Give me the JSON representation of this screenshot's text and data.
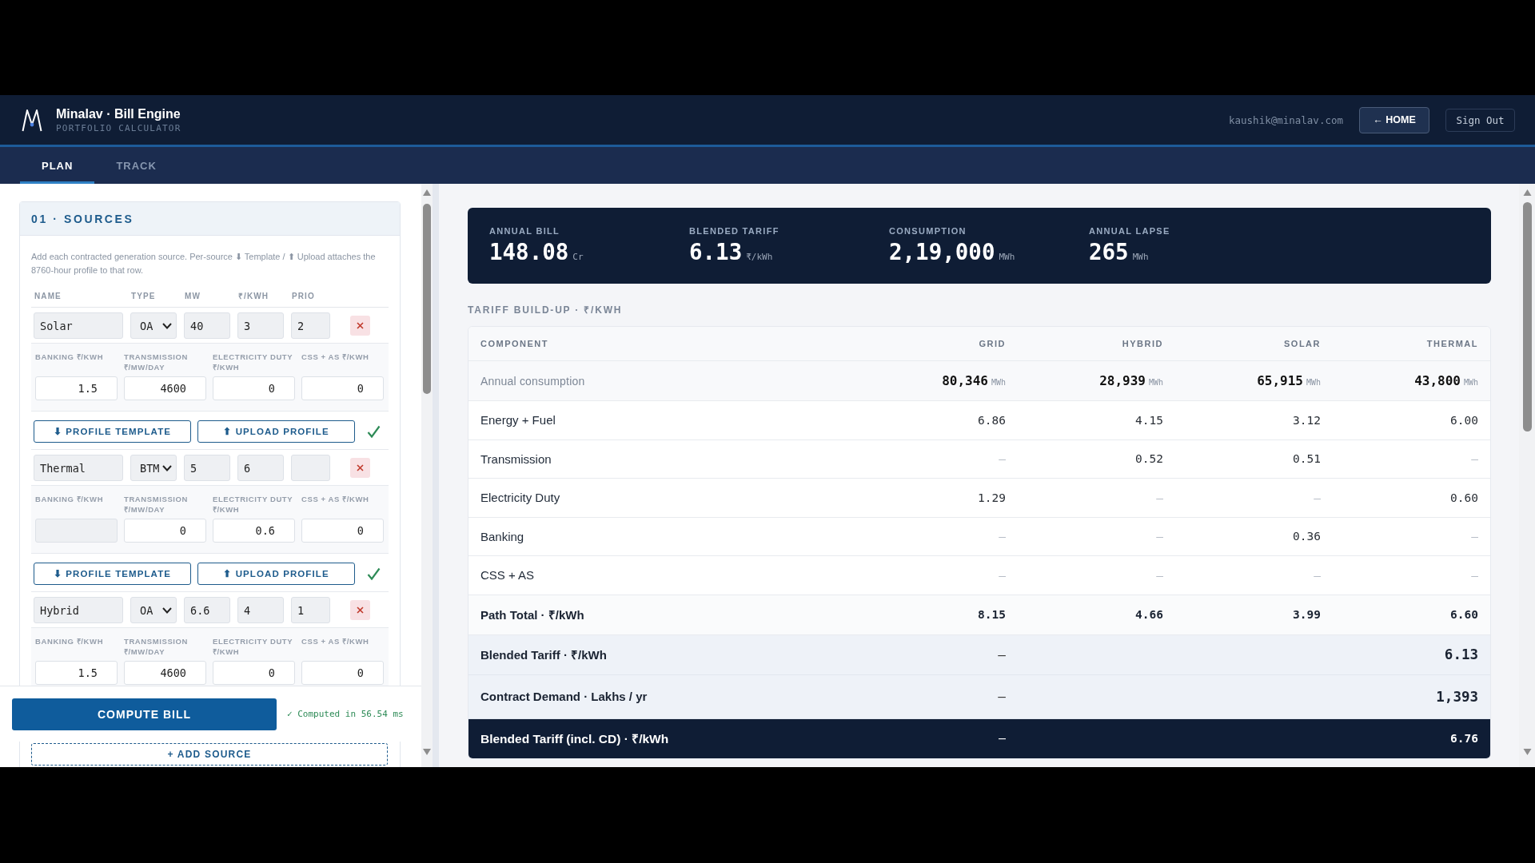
{
  "header": {
    "title": "Minalav · Bill Engine",
    "subtitle": "PORTFOLIO CALCULATOR",
    "user_email": "kaushik@minalav.com",
    "buttons": [
      {
        "label": "← HOME",
        "kind": "home"
      },
      {
        "label": "Sign Out",
        "kind": "sign_out"
      }
    ]
  },
  "tabs": [
    {
      "label": "PLAN",
      "selected": true
    },
    {
      "label": "TRACK",
      "selected": false
    }
  ],
  "sources": {
    "title": "01 · SOURCES",
    "description": "Add each contracted generation source. Per-source ⬇ Template / ⬆ Upload attaches the 8760-hour profile to that row.",
    "columns": [
      "NAME",
      "TYPE",
      "MW",
      "₹/KWH",
      "PRIO"
    ],
    "rows": [
      {
        "name": "Solar",
        "type": "OA",
        "mw": "40",
        "rate": "3",
        "priority": "2",
        "charges": [
          {
            "label": "BANKING ₹/KWH",
            "value": "1.5",
            "disabled": false
          },
          {
            "label": "TRANSMISSION ₹/MW/DAY",
            "value": "4600",
            "disabled": false
          },
          {
            "label": "ELECTRICITY DUTY ₹/KWH",
            "value": "0",
            "disabled": false
          },
          {
            "label": "CSS + AS ₹/KWH",
            "value": "0",
            "disabled": false
          }
        ],
        "actions": [
          "⬇ PROFILE TEMPLATE",
          "⬆ UPLOAD PROFILE"
        ],
        "profile_loaded": true
      },
      {
        "name": "Thermal",
        "type": "BTM",
        "mw": "5",
        "rate": "6",
        "charges": [
          {
            "label": "BANKING ₹/KWH",
            "disabled": true
          },
          {
            "label": "TRANSMISSION ₹/MW/DAY",
            "value": "0",
            "disabled": false
          },
          {
            "label": "ELECTRICITY DUTY ₹/KWH",
            "value": "0.6",
            "disabled": false
          },
          {
            "label": "CSS + AS ₹/KWH",
            "value": "0",
            "disabled": false
          }
        ],
        "actions": [
          "⬇ PROFILE TEMPLATE",
          "⬆ UPLOAD PROFILE"
        ],
        "profile_loaded": true
      },
      {
        "name": "Hybrid",
        "type": "OA",
        "mw": "6.6",
        "rate": "4",
        "priority": "1",
        "charges": [
          {
            "label": "BANKING ₹/KWH",
            "value": "1.5",
            "disabled": false
          },
          {
            "label": "TRANSMISSION ₹/MW/DAY",
            "value": "4600",
            "disabled": false
          },
          {
            "label": "ELECTRICITY DUTY ₹/KWH",
            "value": "0",
            "disabled": false
          },
          {
            "label": "CSS + AS ₹/KWH",
            "value": "0",
            "disabled": false
          }
        ]
      }
    ],
    "compute_button": "COMPUTE BILL",
    "status": "✓ Computed in 56.54 ms",
    "add_button": "+ ADD SOURCE"
  },
  "summary": {
    "metrics": [
      {
        "label": "ANNUAL BILL",
        "value": "148.08",
        "unit": "Cr"
      },
      {
        "label": "BLENDED TARIFF",
        "value": "6.13",
        "unit": "₹/kWh"
      },
      {
        "label": "CONSUMPTION",
        "value": "2,19,000",
        "unit": "MWh"
      },
      {
        "label": "ANNUAL LAPSE",
        "value": "265",
        "unit": "MWh"
      }
    ]
  },
  "tariff_table": {
    "title": "TARIFF BUILD-UP · ₹/KWH",
    "columns": [
      "COMPONENT",
      "GRID",
      "HYBRID",
      "SOLAR",
      "THERMAL"
    ],
    "rows": [
      {
        "kind": "consumption",
        "label": "Annual consumption",
        "values": [
          {
            "text": "80,346",
            "unit": "MWh"
          },
          {
            "text": "28,939",
            "unit": "MWh"
          },
          {
            "text": "65,915",
            "unit": "MWh"
          },
          {
            "text": "43,800",
            "unit": "MWh"
          }
        ]
      },
      {
        "kind": "component",
        "label": "Energy + Fuel",
        "values": [
          {
            "text": "6.86",
            "muted": false
          },
          {
            "text": "4.15",
            "muted": false
          },
          {
            "text": "3.12",
            "muted": false
          },
          {
            "text": "6.00",
            "muted": false
          }
        ]
      },
      {
        "kind": "component",
        "label": "Transmission",
        "values": [
          {
            "text": "—",
            "muted": true
          },
          {
            "text": "0.52",
            "muted": false
          },
          {
            "text": "0.51",
            "muted": false
          },
          {
            "text": "—",
            "muted": true
          }
        ]
      },
      {
        "kind": "component",
        "label": "Electricity Duty",
        "values": [
          {
            "text": "1.29",
            "muted": false
          },
          {
            "text": "—",
            "muted": true
          },
          {
            "text": "—",
            "muted": true
          },
          {
            "text": "0.60",
            "muted": false
          }
        ]
      },
      {
        "kind": "component",
        "label": "Banking",
        "values": [
          {
            "text": "—",
            "muted": true
          },
          {
            "text": "—",
            "muted": true
          },
          {
            "text": "0.36",
            "muted": false
          },
          {
            "text": "—",
            "muted": true
          }
        ]
      },
      {
        "kind": "component",
        "label": "CSS + AS",
        "values": [
          {
            "text": "—",
            "muted": true
          },
          {
            "text": "—",
            "muted": true
          },
          {
            "text": "—",
            "muted": true
          },
          {
            "text": "—",
            "muted": true
          }
        ]
      },
      {
        "kind": "total",
        "label": "Path Total · ₹/kWh",
        "values": [
          {
            "text": "8.15",
            "muted": false
          },
          {
            "text": "4.66",
            "muted": false
          },
          {
            "text": "3.99",
            "muted": false
          },
          {
            "text": "6.60",
            "muted": false
          }
        ]
      },
      {
        "kind": "blended",
        "label": "Blended Tariff · ₹/kWh",
        "grid": "—",
        "thermal": "6.13"
      },
      {
        "kind": "blended",
        "label": "Contract Demand · Lakhs / yr",
        "grid": "—",
        "thermal": "1,393"
      },
      {
        "kind": "final",
        "label": "Blended Tariff (incl. CD) · ₹/kWh",
        "grid": "—",
        "thermal": "6.76"
      }
    ]
  }
}
